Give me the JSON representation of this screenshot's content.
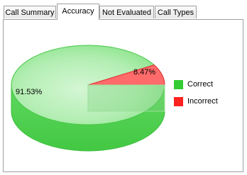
{
  "tabs": [
    {
      "label": "Call Summary",
      "active": false
    },
    {
      "label": "Accuracy",
      "active": true
    },
    {
      "label": "Not Evaluated",
      "active": false
    },
    {
      "label": "Call Types",
      "active": false
    }
  ],
  "chart_data": {
    "type": "pie",
    "title": "",
    "legend_position": "right",
    "slices": [
      {
        "label": "Correct",
        "value": 91.53,
        "display": "91.53%",
        "color": "#33cc33"
      },
      {
        "label": "Incorrect",
        "value": 8.47,
        "display": "8.47%",
        "color": "#ff2020"
      }
    ]
  }
}
